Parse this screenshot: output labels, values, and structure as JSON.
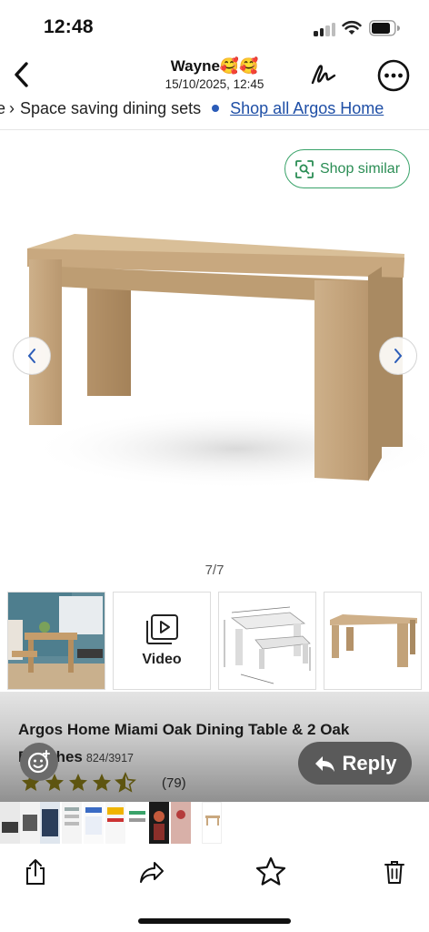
{
  "status_bar": {
    "time": "12:48"
  },
  "nav": {
    "title": "Wayne🥰🥰",
    "subtitle": "15/10/2025, 12:45"
  },
  "breadcrumb": {
    "fragment": "e",
    "current": "Space saving dining sets",
    "link": "Shop all Argos Home"
  },
  "gallery": {
    "shop_similar": "Shop similar",
    "counter": "7/7"
  },
  "thumbnails": {
    "video_label": "Video"
  },
  "product": {
    "title_line1": "Argos Home Miami Oak Dining Table & 2 Oak",
    "title_line2": "Benches",
    "code": "824/3917",
    "rating": 4.5,
    "review_count": "(79)"
  },
  "reply": {
    "label": "Reply"
  },
  "colors": {
    "accent_green": "#3aa36a",
    "link_blue": "#1f4fa6",
    "star": "#6b5a0a"
  }
}
